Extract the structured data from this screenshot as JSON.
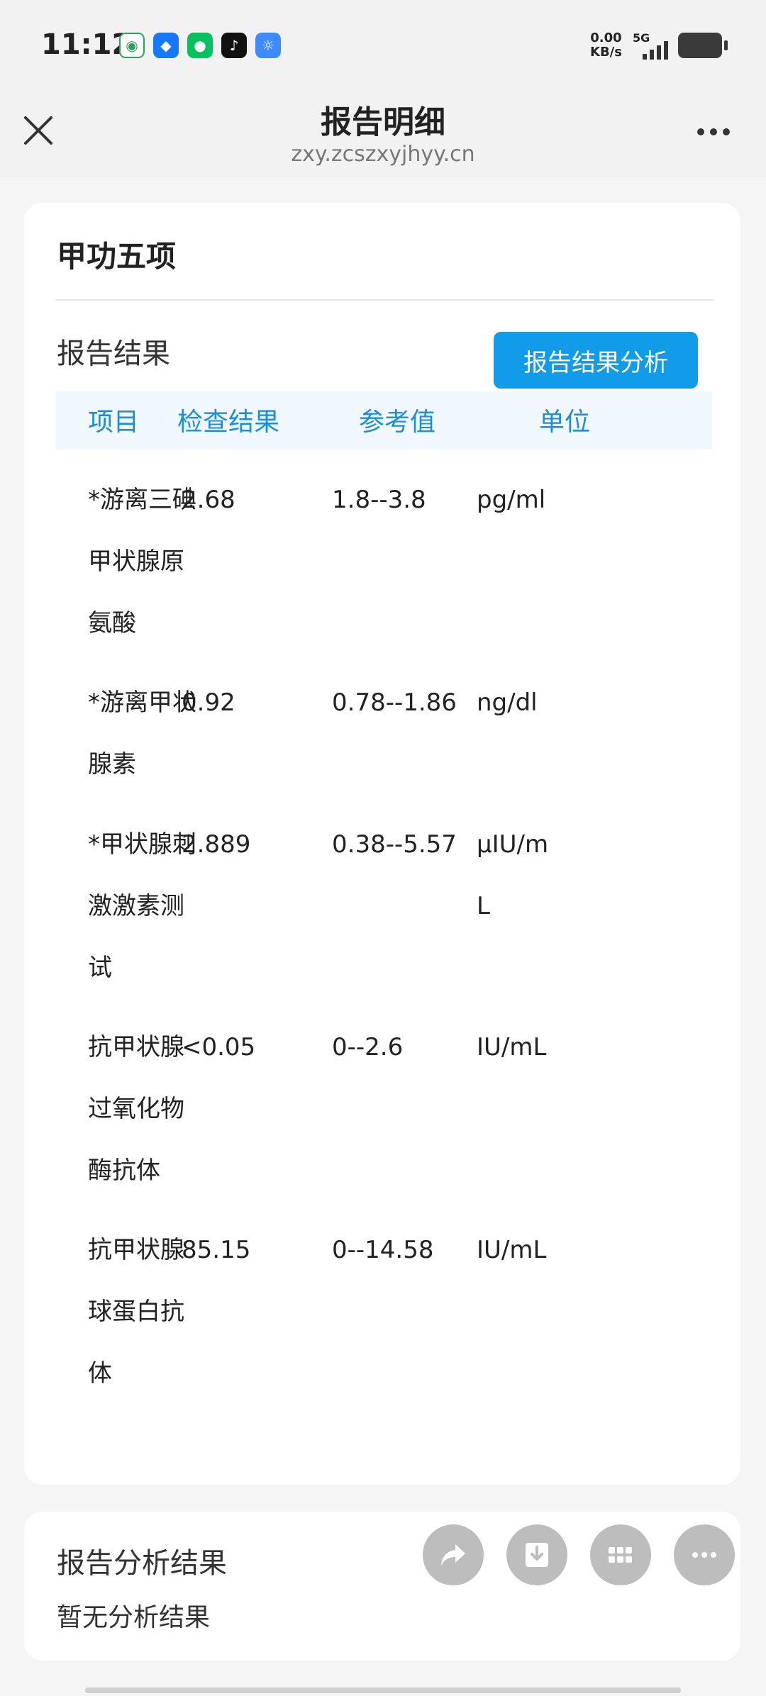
{
  "status": {
    "time": "11:12",
    "net_speed_value": "0.00",
    "net_speed_unit": "KB/s",
    "network": "5G"
  },
  "header": {
    "title": "报告明细",
    "url": "zxy.zcszxyjhyy.cn"
  },
  "report": {
    "section_title": "甲功五项",
    "result_label": "报告结果",
    "analyze_button": "报告结果分析",
    "columns": [
      "项目",
      "检查结果",
      "参考值",
      "单位"
    ],
    "rows": [
      {
        "name_lines": [
          "*游离三碘",
          "甲状腺原",
          "氨酸"
        ],
        "value": "2.68",
        "ref": "1.8--3.8",
        "unit": "pg/ml"
      },
      {
        "name_lines": [
          "*游离甲状",
          "腺素"
        ],
        "value": "0.92",
        "ref": "0.78--1.86",
        "unit": "ng/dl"
      },
      {
        "name_lines": [
          "*甲状腺刺",
          "激激素测",
          "试"
        ],
        "value": "2.889",
        "ref": "0.38--5.57",
        "unit_lines": [
          "µIU/m",
          "L"
        ]
      },
      {
        "name_lines": [
          "抗甲状腺",
          "过氧化物",
          "酶抗体"
        ],
        "value": "<0.05",
        "ref": "0--2.6",
        "unit": "IU/mL"
      },
      {
        "name_lines": [
          "抗甲状腺",
          "球蛋白抗",
          "体"
        ],
        "value": "85.15",
        "ref": "0--14.58",
        "unit": "IU/mL"
      }
    ]
  },
  "analysis": {
    "title": "报告分析结果",
    "empty_text": "暂无分析结果"
  }
}
